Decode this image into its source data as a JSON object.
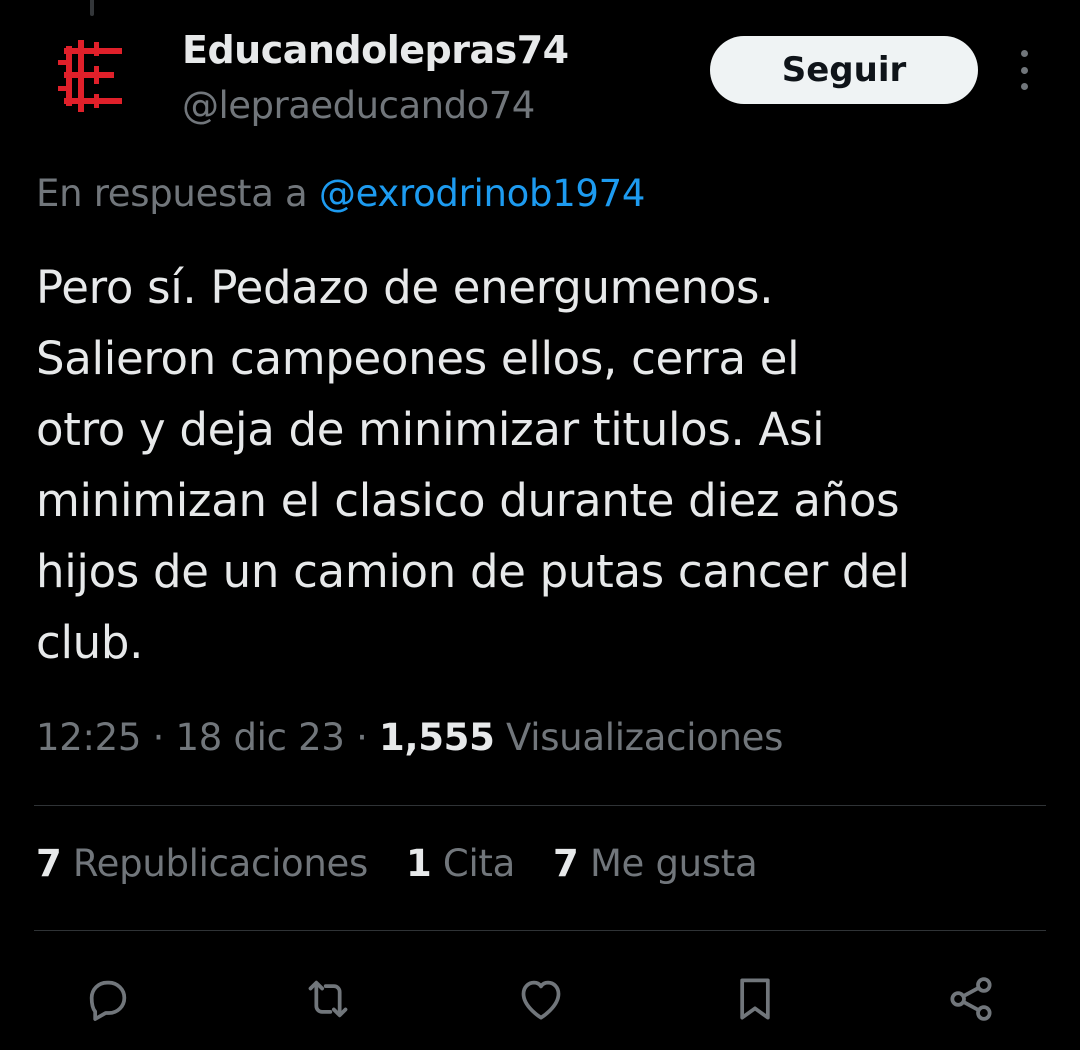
{
  "colors": {
    "background": "#000000",
    "primary_text": "#e7e9ea",
    "secondary_text": "#71767b",
    "link": "#1d9bf0",
    "follow_button_bg": "#eff3f4",
    "avatar_logo": "#e0202a"
  },
  "author": {
    "display_name": "Educandolepras74",
    "handle": "@lepraeducando74",
    "avatar_icon": "lepra-logo-icon"
  },
  "header": {
    "follow_label": "Seguir",
    "more_icon": "more-vertical-icon"
  },
  "reply": {
    "prefix": "En respuesta a",
    "mention": "@exrodrinob1974"
  },
  "tweet": {
    "lines": [
      "Pero sí. Pedazo de energumenos.",
      "Salieron campeones ellos, cerra el",
      "otro y deja de minimizar titulos. Asi",
      "minimizan el clasico durante diez años",
      "hijos de un camion de putas cancer del",
      "club."
    ]
  },
  "meta": {
    "time": "12:25",
    "separator": " · ",
    "date": "18 dic 23",
    "views_count": "1,555",
    "views_label": "Visualizaciones"
  },
  "stats": {
    "reposts_count": "7",
    "reposts_label": "Republicaciones",
    "quotes_count": "1",
    "quotes_label": "Cita",
    "likes_count": "7",
    "likes_label": "Me gusta"
  },
  "actions": {
    "reply_icon": "reply-icon",
    "repost_icon": "repost-icon",
    "like_icon": "heart-icon",
    "bookmark_icon": "bookmark-icon",
    "share_icon": "share-icon"
  }
}
